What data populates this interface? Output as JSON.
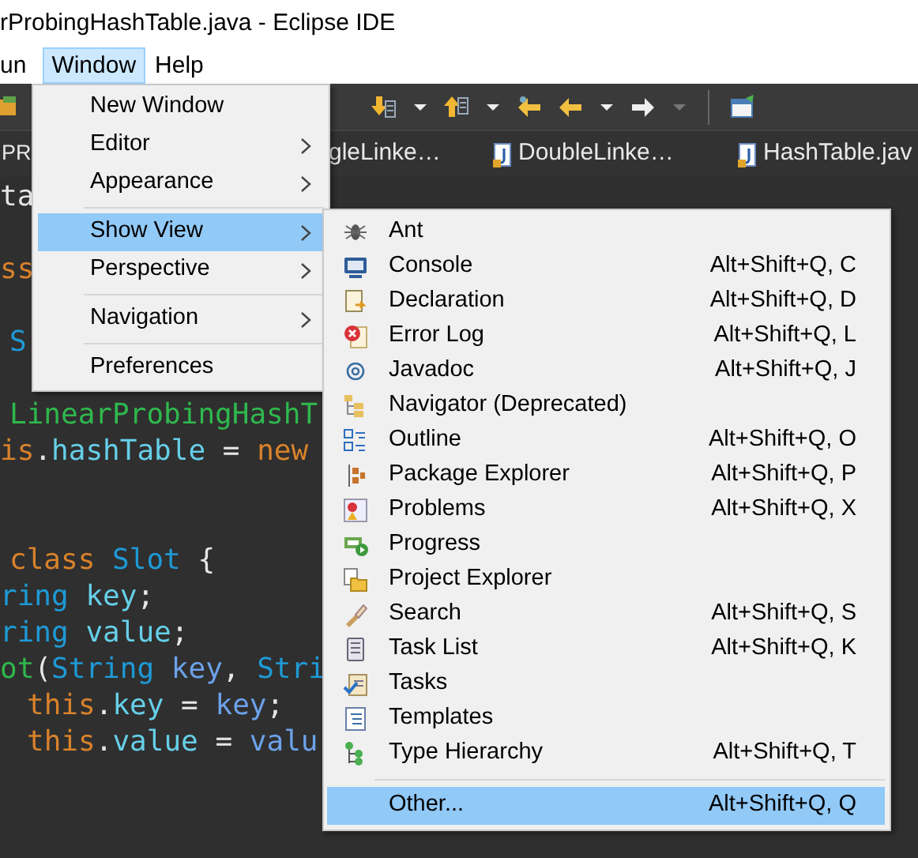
{
  "window": {
    "title": "rProbingHashTable.java - Eclipse IDE"
  },
  "menubar": [
    {
      "label": "un",
      "selected": false
    },
    {
      "label": "Window",
      "selected": true
    },
    {
      "label": "Help",
      "selected": false
    }
  ],
  "tabs": [
    {
      "label": "PR",
      "java_icon": false
    },
    {
      "label": "gleLinke…",
      "java_icon": false
    },
    {
      "label": "DoubleLinke…",
      "java_icon": true
    },
    {
      "label": "HashTable.jav",
      "java_icon": true
    }
  ],
  "code_lines": [
    {
      "kind": "edge",
      "tokens": [
        {
          "kind": "plain",
          "text": "ta"
        }
      ]
    },
    {
      "kind": "blank"
    },
    {
      "kind": "edge",
      "tokens": [
        {
          "kind": "keyword",
          "text": "ss"
        }
      ]
    },
    {
      "kind": "blank"
    },
    {
      "kind": "shifted",
      "tokens": [
        {
          "kind": "type",
          "text": "S"
        }
      ]
    },
    {
      "kind": "blank"
    },
    {
      "kind": "shifted",
      "tokens": [
        {
          "kind": "method",
          "text": "LinearProbingHashT"
        }
      ]
    },
    {
      "kind": "edge",
      "tokens": [
        {
          "kind": "keyword",
          "text": "is"
        },
        {
          "kind": "plain",
          "text": "."
        },
        {
          "kind": "field",
          "text": "hashTable"
        },
        {
          "kind": "plain",
          "text": " = "
        },
        {
          "kind": "keyword",
          "text": "new"
        }
      ]
    },
    {
      "kind": "blank"
    },
    {
      "kind": "blank"
    },
    {
      "kind": "shifted",
      "tokens": [
        {
          "kind": "keyword",
          "text": "class "
        },
        {
          "kind": "type",
          "text": "Slot"
        },
        {
          "kind": "plain",
          "text": " {"
        }
      ]
    },
    {
      "kind": "edge",
      "tokens": [
        {
          "kind": "type",
          "text": "ring "
        },
        {
          "kind": "field",
          "text": "key"
        },
        {
          "kind": "plain",
          "text": ";"
        }
      ]
    },
    {
      "kind": "edge",
      "tokens": [
        {
          "kind": "type",
          "text": "ring "
        },
        {
          "kind": "field",
          "text": "value"
        },
        {
          "kind": "plain",
          "text": ";"
        }
      ]
    },
    {
      "kind": "edge",
      "tokens": [
        {
          "kind": "method",
          "text": "ot"
        },
        {
          "kind": "plain",
          "text": "("
        },
        {
          "kind": "type",
          "text": "String "
        },
        {
          "kind": "param",
          "text": "key"
        },
        {
          "kind": "plain",
          "text": ", "
        },
        {
          "kind": "type",
          "text": "Stri"
        }
      ]
    },
    {
      "kind": "nested",
      "tokens": [
        {
          "kind": "keyword",
          "text": "this"
        },
        {
          "kind": "plain",
          "text": "."
        },
        {
          "kind": "field",
          "text": "key"
        },
        {
          "kind": "plain",
          "text": " = "
        },
        {
          "kind": "param",
          "text": "key"
        },
        {
          "kind": "plain",
          "text": ";"
        }
      ]
    },
    {
      "kind": "nested",
      "tokens": [
        {
          "kind": "keyword",
          "text": "this"
        },
        {
          "kind": "plain",
          "text": "."
        },
        {
          "kind": "field",
          "text": "value"
        },
        {
          "kind": "plain",
          "text": " = "
        },
        {
          "kind": "param",
          "text": "valu"
        }
      ]
    }
  ],
  "window_menu": [
    {
      "kind": "item",
      "label": "New Window",
      "selected": false
    },
    {
      "kind": "submenu",
      "label": "Editor",
      "selected": false
    },
    {
      "kind": "submenu",
      "label": "Appearance",
      "selected": false
    },
    {
      "kind": "separator"
    },
    {
      "kind": "submenu",
      "label": "Show View",
      "selected": true
    },
    {
      "kind": "submenu",
      "label": "Perspective",
      "selected": false
    },
    {
      "kind": "separator"
    },
    {
      "kind": "submenu",
      "label": "Navigation",
      "selected": false
    },
    {
      "kind": "separator"
    },
    {
      "kind": "item",
      "label": "Preferences",
      "selected": false
    }
  ],
  "show_view_menu": [
    {
      "kind": "item",
      "label": "Ant",
      "selected": false
    },
    {
      "kind": "item",
      "label": "Console",
      "shortcut": "Alt+Shift+Q, C",
      "selected": false
    },
    {
      "kind": "item",
      "label": "Declaration",
      "shortcut": "Alt+Shift+Q, D",
      "selected": false
    },
    {
      "kind": "item",
      "label": "Error Log",
      "shortcut": "Alt+Shift+Q, L",
      "selected": false
    },
    {
      "kind": "item",
      "label": "Javadoc",
      "shortcut": "Alt+Shift+Q, J",
      "selected": false
    },
    {
      "kind": "item",
      "label": "Navigator (Deprecated)",
      "selected": false
    },
    {
      "kind": "item",
      "label": "Outline",
      "shortcut": "Alt+Shift+Q, O",
      "selected": false
    },
    {
      "kind": "item",
      "label": "Package Explorer",
      "shortcut": "Alt+Shift+Q, P",
      "selected": false
    },
    {
      "kind": "item",
      "label": "Problems",
      "shortcut": "Alt+Shift+Q, X",
      "selected": false
    },
    {
      "kind": "item",
      "label": "Progress",
      "selected": false
    },
    {
      "kind": "item",
      "label": "Project Explorer",
      "selected": false
    },
    {
      "kind": "item",
      "label": "Search",
      "shortcut": "Alt+Shift+Q, S",
      "selected": false
    },
    {
      "kind": "item",
      "label": "Task List",
      "shortcut": "Alt+Shift+Q, K",
      "selected": false
    },
    {
      "kind": "item",
      "label": "Tasks",
      "selected": false
    },
    {
      "kind": "item",
      "label": "Templates",
      "selected": false
    },
    {
      "kind": "item",
      "label": "Type Hierarchy",
      "shortcut": "Alt+Shift+Q, T",
      "selected": false
    },
    {
      "kind": "separator"
    },
    {
      "kind": "item",
      "label": "Other...",
      "shortcut": "Alt+Shift+Q, Q",
      "selected": true
    }
  ]
}
